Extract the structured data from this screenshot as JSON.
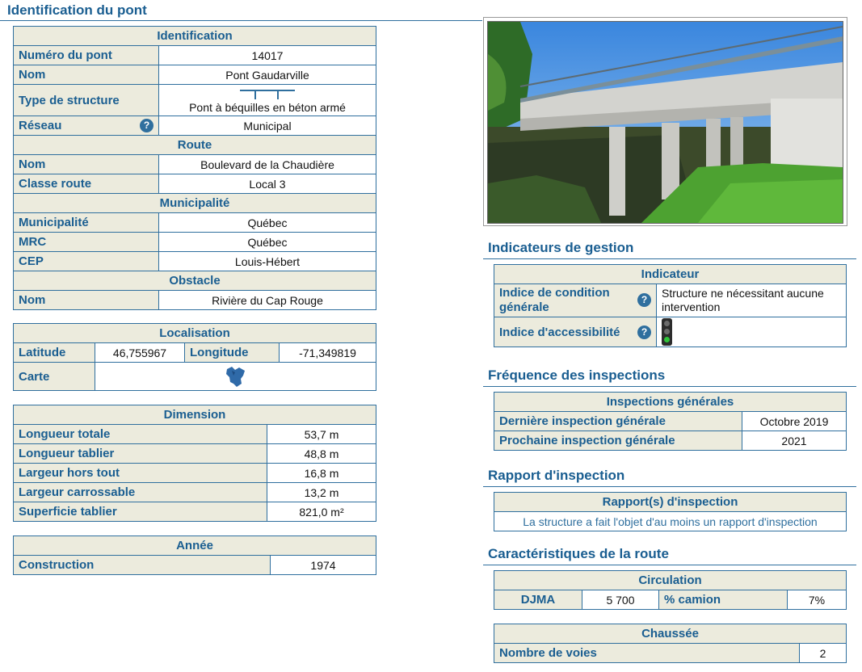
{
  "page_title": "Identification du pont",
  "identification": {
    "header": "Identification",
    "numero_label": "Numéro du pont",
    "numero_value": "14017",
    "nom_label": "Nom",
    "nom_value": "Pont Gaudarville",
    "type_label": "Type de structure",
    "type_value": "Pont à béquilles en béton armé",
    "reseau_label": "Réseau",
    "reseau_value": "Municipal",
    "route_header": "Route",
    "route_nom_label": "Nom",
    "route_nom_value": "Boulevard de la Chaudière",
    "classe_label": "Classe route",
    "classe_value": "Local 3",
    "municipalite_header": "Municipalité",
    "municipalite_label": "Municipalité",
    "municipalite_value": "Québec",
    "mrc_label": "MRC",
    "mrc_value": "Québec",
    "cep_label": "CEP",
    "cep_value": "Louis-Hébert",
    "obstacle_header": "Obstacle",
    "obstacle_nom_label": "Nom",
    "obstacle_nom_value": "Rivière du Cap Rouge"
  },
  "localisation": {
    "header": "Localisation",
    "latitude_label": "Latitude",
    "latitude_value": "46,755967",
    "longitude_label": "Longitude",
    "longitude_value": "-71,349819",
    "carte_label": "Carte"
  },
  "dimension": {
    "header": "Dimension",
    "rows": [
      {
        "label": "Longueur totale",
        "value": "53,7 m"
      },
      {
        "label": "Longueur tablier",
        "value": "48,8 m"
      },
      {
        "label": "Largeur hors tout",
        "value": "16,8 m"
      },
      {
        "label": "Largeur carrossable",
        "value": "13,2 m"
      },
      {
        "label": "Superficie tablier",
        "value": "821,0 m²"
      }
    ]
  },
  "annee": {
    "header": "Année",
    "construction_label": "Construction",
    "construction_value": "1974"
  },
  "gestion": {
    "title": "Indicateurs de gestion",
    "header": "Indicateur",
    "condition_label": "Indice de condition générale",
    "condition_value": "Structure ne nécessitant aucune intervention",
    "accessibilite_label": "Indice d'accessibilité",
    "light_colors": {
      "off": "#6b6b6b",
      "on": "#2fc43a"
    }
  },
  "frequence": {
    "title": "Fréquence des inspections",
    "header": "Inspections générales",
    "derniere_label": "Dernière inspection générale",
    "derniere_value": "Octobre 2019",
    "prochaine_label": "Prochaine inspection générale",
    "prochaine_value": "2021"
  },
  "rapport": {
    "title": "Rapport d'inspection",
    "header": "Rapport(s) d'inspection",
    "note": "La structure a fait l'objet d'au moins un rapport d'inspection"
  },
  "route_caracteristiques": {
    "title": "Caractéristiques de la route",
    "circulation_header": "Circulation",
    "djma_label": "DJMA",
    "djma_value": "5 700",
    "camion_label": "% camion",
    "camion_value": "7%",
    "chaussee_header": "Chaussée",
    "voies_label": "Nombre de voies",
    "voies_value": "2"
  },
  "icons": {
    "help": "?"
  },
  "colors": {
    "accent": "#1a5e91",
    "border": "#2f6f9e",
    "header_bg": "#ecebdd"
  }
}
